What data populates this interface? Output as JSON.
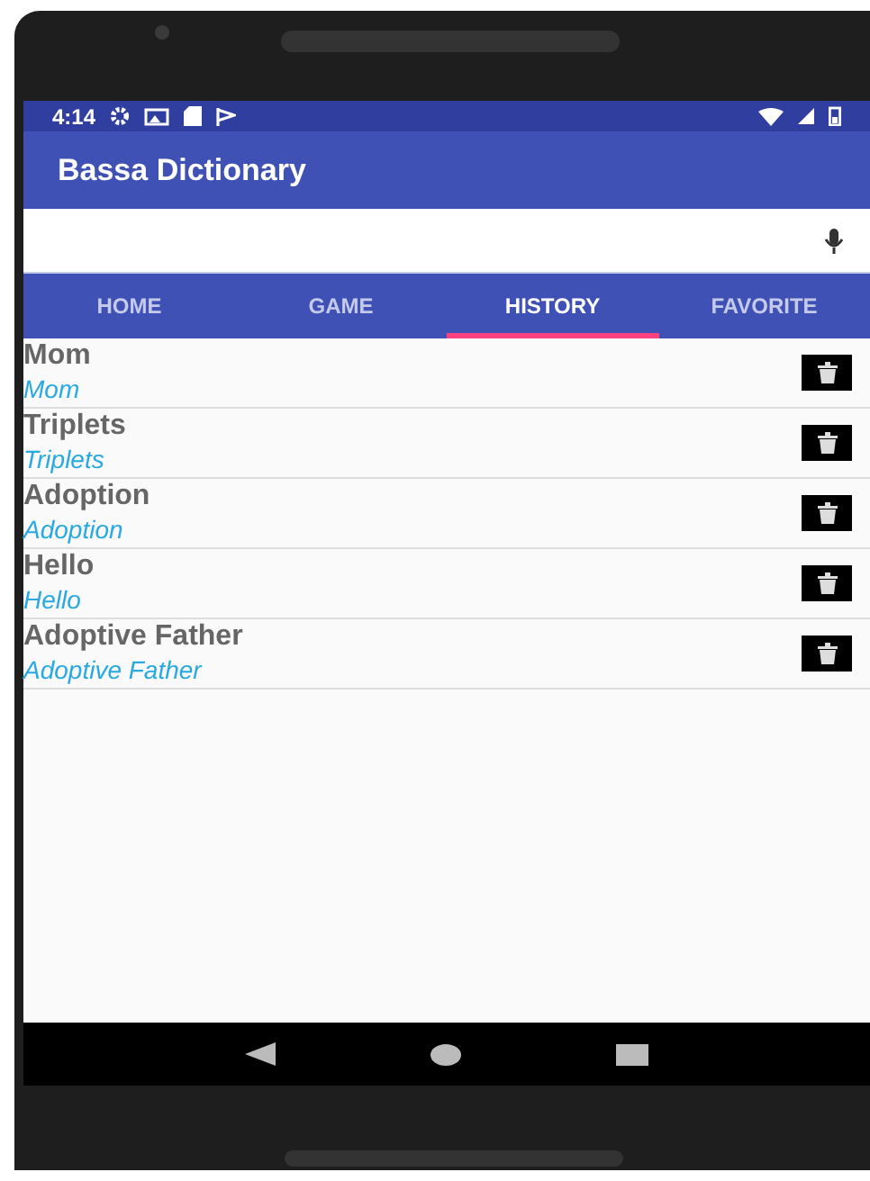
{
  "status_bar": {
    "time": "4:14"
  },
  "app_bar": {
    "title": "Bassa Dictionary"
  },
  "tabs": [
    {
      "label": "HOME",
      "selected": false
    },
    {
      "label": "GAME",
      "selected": false
    },
    {
      "label": "HISTORY",
      "selected": true
    },
    {
      "label": "FAVORITE",
      "selected": false
    }
  ],
  "history": [
    {
      "word": "Mom",
      "translation": "Mom"
    },
    {
      "word": "Triplets",
      "translation": "Triplets"
    },
    {
      "word": "Adoption",
      "translation": "Adoption"
    },
    {
      "word": "Hello",
      "translation": "Hello"
    },
    {
      "word": "Adoptive Father",
      "translation": "Adoptive Father"
    }
  ]
}
